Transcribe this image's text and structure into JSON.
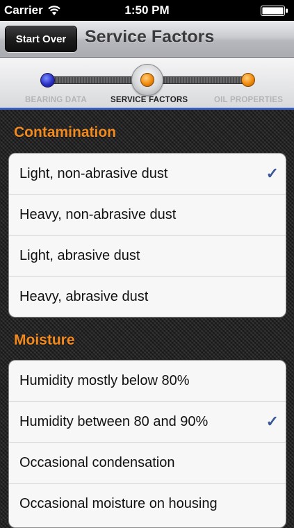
{
  "status_bar": {
    "carrier": "Carrier",
    "time": "1:50 PM"
  },
  "nav": {
    "start_over_label": "Start Over",
    "title": "Service Factors"
  },
  "steps": [
    {
      "label": "BEARING DATA",
      "state": "complete"
    },
    {
      "label": "SERVICE FACTORS",
      "state": "active"
    },
    {
      "label": "OIL PROPERTIES",
      "state": "pending"
    }
  ],
  "colors": {
    "accent_orange": "#f28a1e",
    "check_blue": "#3b5998",
    "progress_line": "#3a5ec0"
  },
  "sections": [
    {
      "title": "Contamination",
      "options": [
        {
          "label": "Light, non-abrasive dust",
          "checked": true
        },
        {
          "label": "Heavy, non-abrasive dust",
          "checked": false
        },
        {
          "label": "Light, abrasive dust",
          "checked": false
        },
        {
          "label": "Heavy, abrasive dust",
          "checked": false
        }
      ]
    },
    {
      "title": "Moisture",
      "options": [
        {
          "label": "Humidity mostly below 80%",
          "checked": false
        },
        {
          "label": "Humidity between 80 and 90%",
          "checked": true
        },
        {
          "label": "Occasional condensation",
          "checked": false
        },
        {
          "label": "Occasional moisture on housing",
          "checked": false
        }
      ]
    }
  ],
  "checkmark_glyph": "✓"
}
